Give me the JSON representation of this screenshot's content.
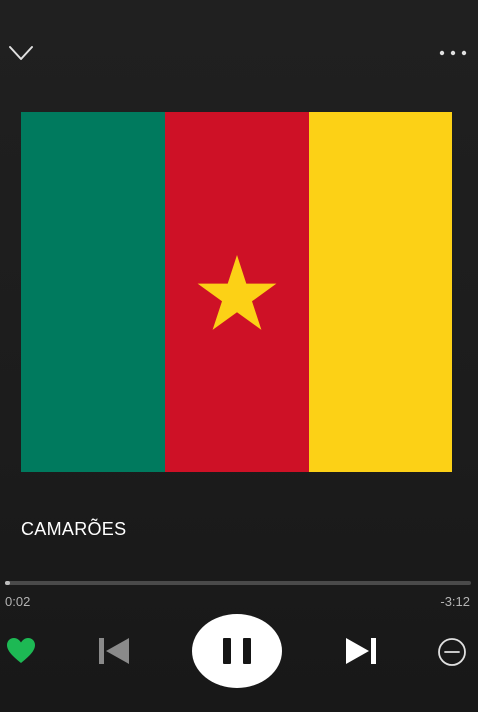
{
  "header": {
    "collapse_icon": "chevron-down-icon",
    "menu_icon": "more-horizontal-icon"
  },
  "artwork": {
    "description_icon": "cameroon-flag",
    "colors": {
      "green": "#007a5e",
      "red": "#ce1126",
      "yellow": "#fcd116",
      "star": "#fcd116"
    }
  },
  "track": {
    "title": "CAMARÕES"
  },
  "playback": {
    "elapsed": "0:02",
    "remaining": "-3:12",
    "progress_fraction": 0.01
  },
  "controls": {
    "like_icon": "heart-icon",
    "like_color": "#1db954",
    "prev_icon": "skip-previous-icon",
    "play_pause_icon": "pause-icon",
    "next_icon": "skip-next-icon",
    "hide_icon": "minus-circle-icon"
  }
}
